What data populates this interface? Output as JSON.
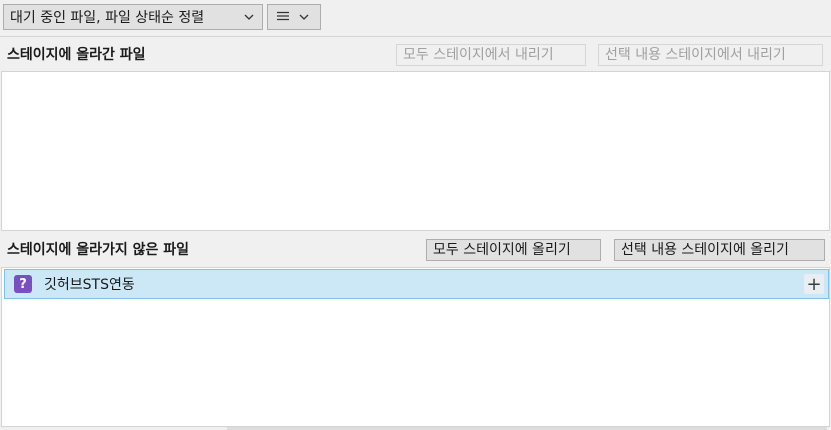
{
  "toolbar": {
    "sort_label": "대기 중인 파일, 파일 상태순 정렬",
    "view_icon": "list-lines-icon"
  },
  "staged": {
    "title": "스테이지에 올라간 파일",
    "unstage_all_label": "모두 스테이지에서 내리기",
    "unstage_selected_label": "선택 내용 스테이지에서 내리기",
    "files": []
  },
  "unstaged": {
    "title": "스테이지에 올라가지 않은 파일",
    "stage_all_label": "모두 스테이지에 올리기",
    "stage_selected_label": "선택 내용 스테이지에 올리기",
    "files": [
      {
        "name": "깃허브STS연동",
        "status_icon": "unknown-question-icon",
        "status_glyph": "?",
        "action_icon": "plus-icon"
      }
    ]
  },
  "colors": {
    "selected_row": "#cce8f6",
    "selected_border": "#7ec4e6",
    "unknown_status": "#7a4fbf"
  }
}
